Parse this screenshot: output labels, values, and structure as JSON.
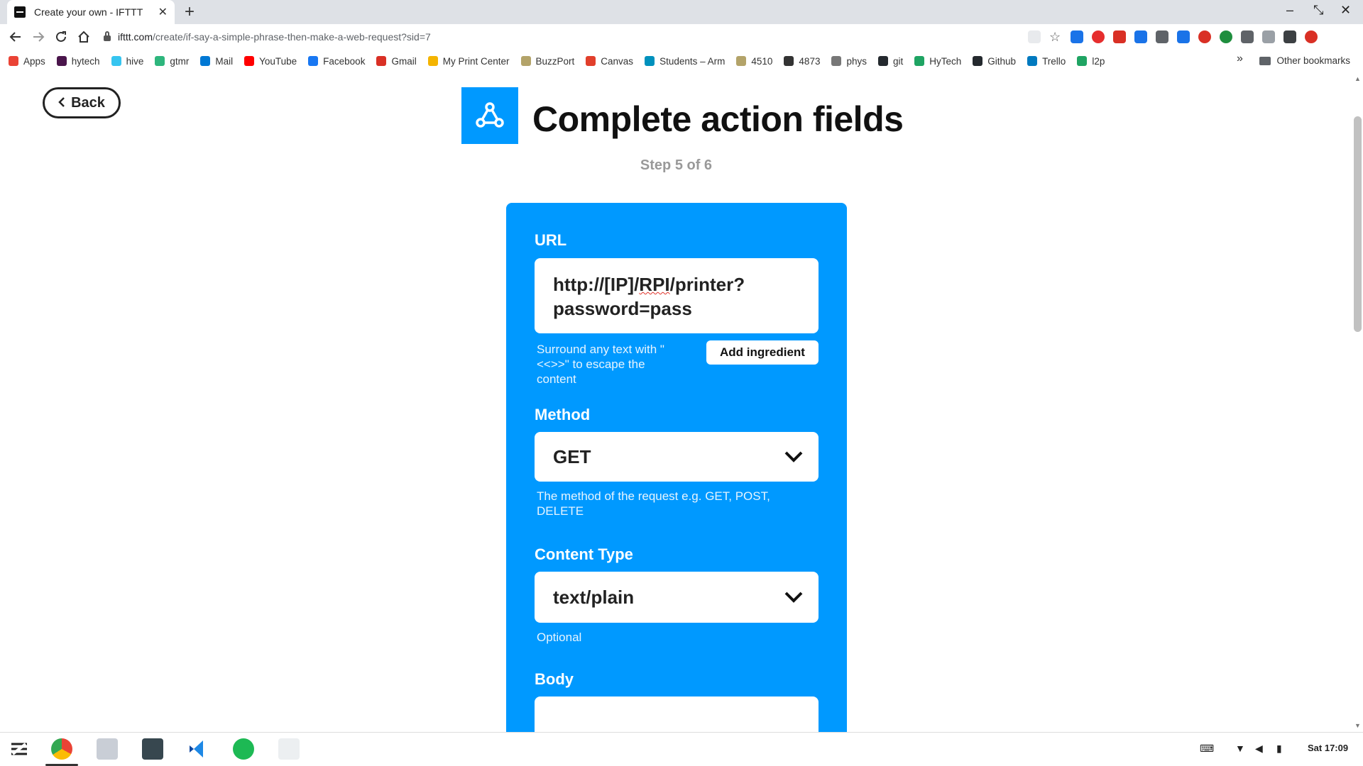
{
  "browser": {
    "tab_title": "Create your own - IFTTT",
    "tab_close": "✕",
    "new_tab": "+",
    "url_domain": "ifttt.com",
    "url_path": "/create/if-say-a-simple-phrase-then-make-a-web-request?sid=7",
    "window_controls": {
      "minimize": "–",
      "restore": "⤡",
      "close": "✕"
    },
    "bookmarks": [
      {
        "label": "Apps",
        "color": "#ea4335"
      },
      {
        "label": "hytech",
        "color": "#4a154b"
      },
      {
        "label": "hive",
        "color": "#36c5f0"
      },
      {
        "label": "gtmr",
        "color": "#2eb67d"
      },
      {
        "label": "Mail",
        "color": "#0078d4"
      },
      {
        "label": "YouTube",
        "color": "#ff0000"
      },
      {
        "label": "Facebook",
        "color": "#1877f2"
      },
      {
        "label": "Gmail",
        "color": "#d93025"
      },
      {
        "label": "My Print Center",
        "color": "#f4b400"
      },
      {
        "label": "BuzzPort",
        "color": "#b3a369"
      },
      {
        "label": "Canvas",
        "color": "#e13f2b"
      },
      {
        "label": "Students – Arm",
        "color": "#0091bd"
      },
      {
        "label": "4510",
        "color": "#b3a369"
      },
      {
        "label": "4873",
        "color": "#333333"
      },
      {
        "label": "phys",
        "color": "#777777"
      },
      {
        "label": "git",
        "color": "#24292e"
      },
      {
        "label": "HyTech",
        "color": "#1fa463"
      },
      {
        "label": "Github",
        "color": "#24292e"
      },
      {
        "label": "Trello",
        "color": "#0079bf"
      },
      {
        "label": "l2p",
        "color": "#1fa463"
      }
    ],
    "bookmarks_overflow": "»",
    "other_bookmarks": "Other bookmarks"
  },
  "page": {
    "back_label": "Back",
    "title": "Complete action fields",
    "step": "Step 5 of 6",
    "accent": "#0099ff"
  },
  "form": {
    "url": {
      "label": "URL",
      "value_part1": "http://[IP]/",
      "value_squiggle": "RPI",
      "value_part2": "/printer?",
      "value_line2": "password=pass",
      "helper": "Surround any text with \"<<>>\" to escape the content",
      "add_ingredient": "Add ingredient"
    },
    "method": {
      "label": "Method",
      "value": "GET",
      "helper": "The method of the request e.g. GET, POST, DELETE"
    },
    "content_type": {
      "label": "Content Type",
      "value": "text/plain",
      "helper": "Optional"
    },
    "body": {
      "label": "Body",
      "value": ""
    }
  },
  "taskbar": {
    "time": "Sat 17:09"
  }
}
